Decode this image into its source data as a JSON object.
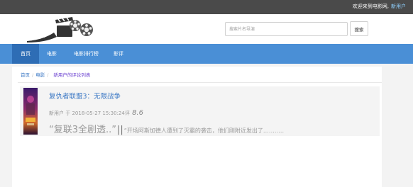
{
  "topbar": {
    "welcome": "欢迎来到电影网,",
    "user": "新用户"
  },
  "search": {
    "placeholder": "搜索片名导演",
    "button": "搜索"
  },
  "nav": {
    "items": [
      "首页",
      "电影",
      "电影排行榜",
      "影评"
    ]
  },
  "breadcrumb": {
    "items": [
      "首页",
      "电影"
    ],
    "current": "新用户的评论列表"
  },
  "review": {
    "title": "复仇者联盟3：无限战争",
    "author": "新用户",
    "by": "于",
    "date": "2018-05-27 15:30:24",
    "score_label": "评",
    "score": "8.6",
    "headline": "“复联3全剧透..”",
    "separator": "||",
    "body": "“开场阿斯加德人遭到了灭霸的袭击，他们刚附近发出了……….."
  }
}
